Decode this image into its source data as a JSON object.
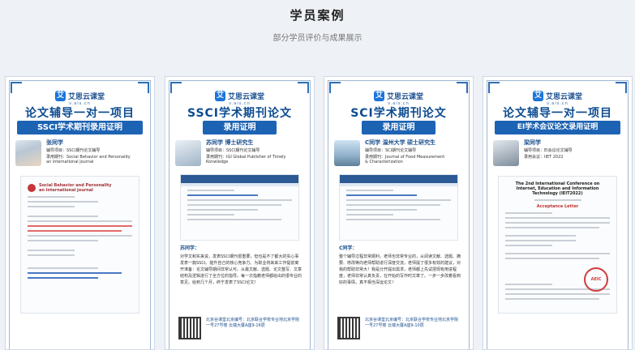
{
  "section": {
    "title": "学员案例",
    "subtitle": "部分学员评价与成果展示"
  },
  "cards": [
    {
      "logo": {
        "name": "艾思云课堂",
        "url": "v.ais.cn"
      },
      "headline": "论文辅导一对一项目",
      "ribbon": "SSCI学术期刊录用证明",
      "student": {
        "name": "张同学",
        "line1": "辅导项目：SSCI期刊论文辅导",
        "line2": "录用期刊：Social Behavior and Personality",
        "line3": "an international journal"
      },
      "doc": {
        "brand": "Social Behavior and Personality",
        "brand_sub": "an international journal"
      },
      "footer": {
        "address": ""
      }
    },
    {
      "logo": {
        "name": "艾思云课堂",
        "url": "v.ais.cn"
      },
      "headline": "SSCI学术期刊论文",
      "ribbon": "录用证明",
      "student": {
        "name": "苏同学  博士研究生",
        "line1": "辅导项目：SSCI期刊论文辅导",
        "line2": "录用期刊：IGI Global Publisher of Timely",
        "line3": "Konwledge"
      },
      "blurb": {
        "name": "苏同学：",
        "text": "对学文和实来说，发表SSCI期刊很重要，但也是不了都大的实心事发表一篇SSCI。能升自己的核心竞争力。为职业将来来工作提前离开准备：论文辅导期间非常认可。从最文献、选题、论文整写、文章结构及逻辑进行了全方位的指导。每一次指教老师都给出的很专业的意见。给到几个月，终于发表了SSCI论文！"
      },
      "footer": {
        "address": "北京谷课堂北京编号：北京联合学校专业地北京学院一号27号楼 云端大厦A座9-16层"
      }
    },
    {
      "logo": {
        "name": "艾思云课堂",
        "url": "v.ais.cn"
      },
      "headline": "SCI学术期刊论文",
      "ribbon": "录用证明",
      "student": {
        "name": "C同学  温州大学 硕士研究生",
        "line1": "辅导项目：SCI期刊论文辅导",
        "line2": "录用期刊：Journal of Food Measurement",
        "line3": "& Characterization"
      },
      "blurb": {
        "name": "C同学：",
        "text": "整个辅导过程非常顺利，老师也非常专业的，从阅读文献、选题、摘要、修改等向老师帮助进行深度交流，老师提了很多有效的建议，对我的帮助非常大！我是分开提出需求，老师都上先试把现有用进程度，老师非常认真负责，在开始的写作时文章了。一步一步改着看到好的事情，真不相当深运论文！"
      },
      "footer": {
        "address": "北京谷课堂北京编号：北京联合学校专业地北京学院一号27号楼 云端大厦A座9-10层"
      }
    },
    {
      "logo": {
        "name": "艾思云课堂",
        "url": "v.ais.cn"
      },
      "headline": "论文辅导一对一项目",
      "ribbon": "EI学术会议论文录用证明",
      "student": {
        "name": "梁同学",
        "line1": "辅导项目：EI会议论文辅导",
        "line2": "录用会议：IIET 2022",
        "line3": ""
      },
      "doc": {
        "title": "The 2nd International Conference on Internet, Education and Information Technology (IEIT2022)",
        "accept": "Acceptance Letter",
        "stamp": "AEIC"
      },
      "footer": {
        "address": ""
      }
    }
  ]
}
